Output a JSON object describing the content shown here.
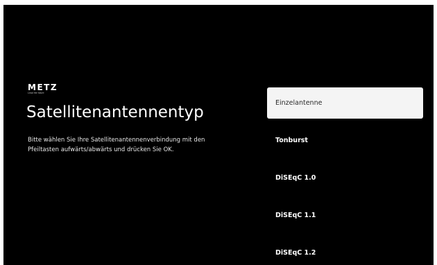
{
  "brand": {
    "logo": "METZ",
    "tagline": "Lead the future"
  },
  "page": {
    "title": "Satellitenantennentyp",
    "description": "Bitte wählen Sie Ihre Satellitenantennenverbindung mit den Pfeiltasten aufwärts/abwärts und drücken Sie OK."
  },
  "options": [
    {
      "label": "Einzelantenne",
      "selected": true
    },
    {
      "label": "Tonburst",
      "selected": false
    },
    {
      "label": "DiSEqC 1.0",
      "selected": false
    },
    {
      "label": "DiSEqC 1.1",
      "selected": false
    },
    {
      "label": "DiSEqC 1.2",
      "selected": false
    }
  ],
  "colors": {
    "background": "#000000",
    "selected_background": "#f4f4f4",
    "selected_text": "#2a2a2a",
    "text": "#ffffff"
  }
}
